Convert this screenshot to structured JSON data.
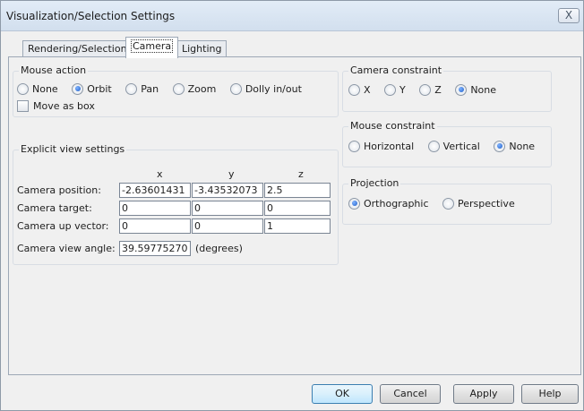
{
  "window": {
    "title": "Visualization/Selection Settings",
    "close_label": "X"
  },
  "tabs": [
    {
      "label": "Rendering/Selection"
    },
    {
      "label": "Camera"
    },
    {
      "label": "Lighting"
    }
  ],
  "mouse_action": {
    "title": "Mouse action",
    "options": [
      "None",
      "Orbit",
      "Pan",
      "Zoom",
      "Dolly in/out"
    ],
    "selected": "Orbit",
    "move_as_box_label": "Move as box",
    "move_as_box_checked": false
  },
  "explicit_view": {
    "title": "Explicit view settings",
    "column_headers": [
      "x",
      "y",
      "z"
    ],
    "rows": [
      {
        "label": "Camera position:",
        "values": [
          "-2.63601431",
          "-3.43532073",
          "2.5"
        ]
      },
      {
        "label": "Camera target:",
        "values": [
          "0",
          "0",
          "0"
        ]
      },
      {
        "label": "Camera up vector:",
        "values": [
          "0",
          "0",
          "1"
        ]
      }
    ],
    "view_angle_label": "Camera view angle:",
    "view_angle_value": "39.59775270",
    "view_angle_unit": "(degrees)"
  },
  "camera_constraint": {
    "title": "Camera constraint",
    "options": [
      "X",
      "Y",
      "Z",
      "None"
    ],
    "selected": "None"
  },
  "mouse_constraint": {
    "title": "Mouse constraint",
    "options": [
      "Horizontal",
      "Vertical",
      "None"
    ],
    "selected": "None"
  },
  "projection": {
    "title": "Projection",
    "options": [
      "Orthographic",
      "Perspective"
    ],
    "selected": "Orthographic"
  },
  "buttons": {
    "ok": "OK",
    "cancel": "Cancel",
    "apply": "Apply",
    "help": "Help"
  }
}
